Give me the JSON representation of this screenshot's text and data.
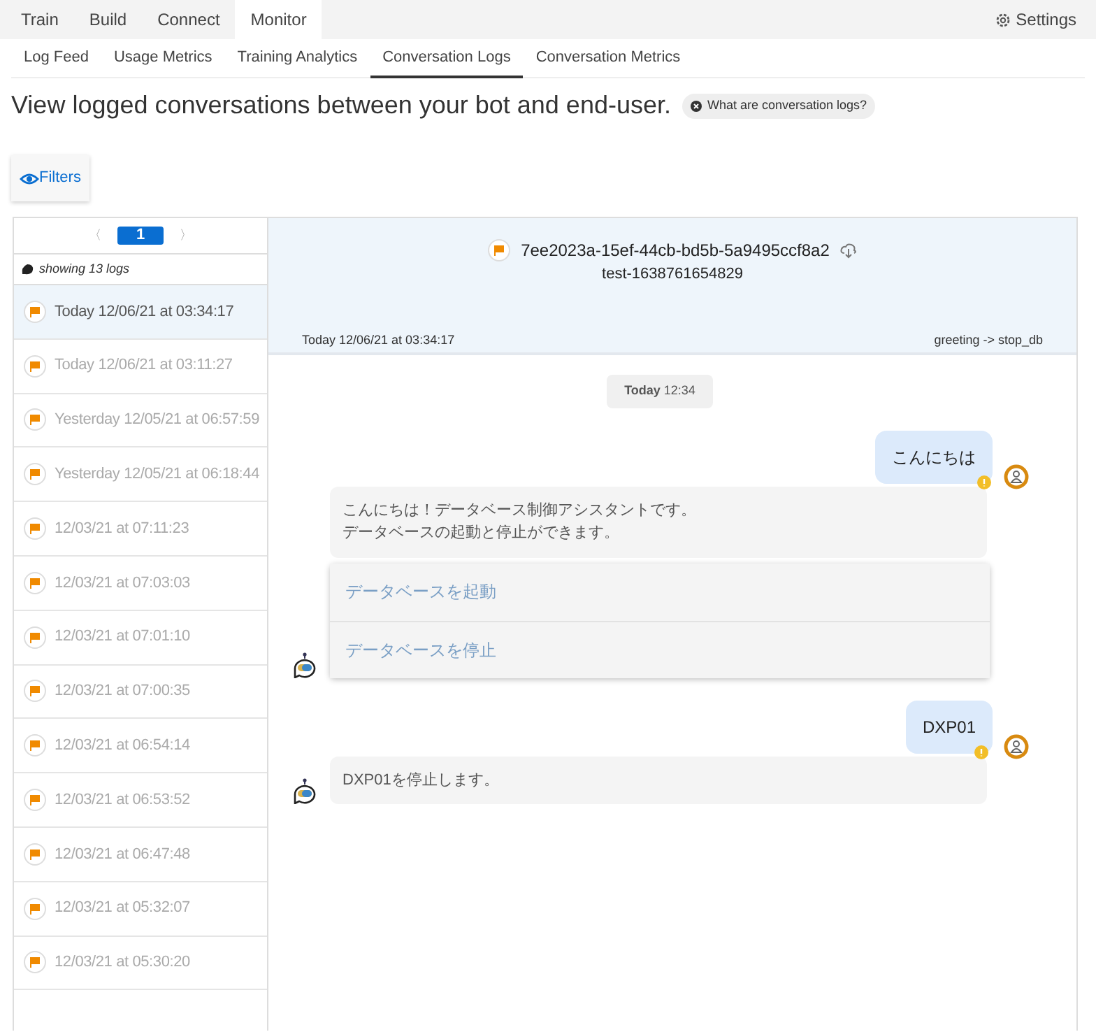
{
  "top_tabs": [
    {
      "label": "Train",
      "selected": false
    },
    {
      "label": "Build",
      "selected": false
    },
    {
      "label": "Connect",
      "selected": false
    },
    {
      "label": "Monitor",
      "selected": true
    }
  ],
  "settings": {
    "label": "Settings"
  },
  "sub_tabs": [
    {
      "label": "Log Feed",
      "selected": false
    },
    {
      "label": "Usage Metrics",
      "selected": false
    },
    {
      "label": "Training Analytics",
      "selected": false
    },
    {
      "label": "Conversation Logs",
      "selected": true
    },
    {
      "label": "Conversation Metrics",
      "selected": false
    }
  ],
  "heading": "View logged conversations between your bot and end-user.",
  "help_chip": "What are conversation logs?",
  "filters_button": "Filters",
  "pagination": {
    "prev": "〈",
    "page": "1",
    "next": "〉"
  },
  "log_count": "showing 13 logs",
  "logs": [
    {
      "label": "Today 12/06/21 at 03:34:17",
      "selected": true
    },
    {
      "label": "Today 12/06/21 at 03:11:27",
      "selected": false
    },
    {
      "label": "Yesterday 12/05/21 at 06:57:59",
      "selected": false
    },
    {
      "label": "Yesterday 12/05/21 at 06:18:44",
      "selected": false
    },
    {
      "label": "12/03/21 at 07:11:23",
      "selected": false
    },
    {
      "label": "12/03/21 at 07:03:03",
      "selected": false
    },
    {
      "label": "12/03/21 at 07:01:10",
      "selected": false
    },
    {
      "label": "12/03/21 at 07:00:35",
      "selected": false
    },
    {
      "label": "12/03/21 at 06:54:14",
      "selected": false
    },
    {
      "label": "12/03/21 at 06:53:52",
      "selected": false
    },
    {
      "label": "12/03/21 at 06:47:48",
      "selected": false
    },
    {
      "label": "12/03/21 at 05:32:07",
      "selected": false
    },
    {
      "label": "12/03/21 at 05:30:20",
      "selected": false
    }
  ],
  "conversation": {
    "id": "7ee2023a-15ef-44cb-bd5b-5a9495ccf8a2",
    "channel": "test-1638761654829",
    "date": "Today 12/06/21 at 03:34:17",
    "flow": "greeting -> stop_db",
    "timestamp": "**Today** 12:34",
    "messages": [
      {
        "kind": "user",
        "lines": [
          "こんにちは"
        ]
      },
      {
        "kind": "bot",
        "lines": [
          "こんにちは！データベース制御アシスタントです。",
          "データベースの起動と停止ができます。"
        ],
        "buttons": [
          "データベースを起動",
          "データベースを停止"
        ]
      },
      {
        "kind": "user",
        "lines": [
          "DXP01"
        ]
      },
      {
        "kind": "bot",
        "lines": [
          "DXP01を停止します。"
        ]
      }
    ]
  }
}
